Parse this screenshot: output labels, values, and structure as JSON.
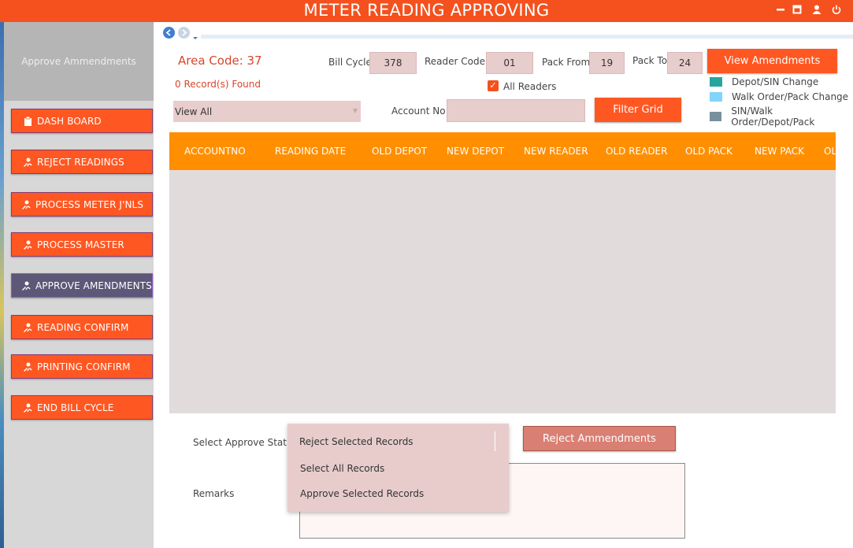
{
  "window": {
    "title": "METER READING APPROVING",
    "controls": [
      {
        "name": "minimize-icon",
        "glyph": "━"
      },
      {
        "name": "maximize-icon",
        "glyph": "▣"
      },
      {
        "name": "user-icon",
        "glyph": "👤"
      },
      {
        "name": "power-icon",
        "glyph": "⏻"
      }
    ]
  },
  "sidebar": {
    "title": "Approve Ammendments",
    "items": [
      {
        "label": "DASH BOARD",
        "icon": "clipboard-icon"
      },
      {
        "label": "REJECT READINGS",
        "icon": "person-edit-icon"
      },
      {
        "label": "PROCESS METER J'NLS",
        "icon": "person-edit-icon"
      },
      {
        "label": "PROCESS MASTER",
        "icon": "person-edit-icon"
      },
      {
        "label": "APPROVE AMENDMENTS",
        "icon": "person-edit-icon",
        "active": true
      },
      {
        "label": "READING CONFIRM",
        "icon": "person-edit-icon"
      },
      {
        "label": "PRINTING CONFIRM",
        "icon": "person-edit-icon"
      },
      {
        "label": "END BILL CYCLE",
        "icon": "person-edit-icon"
      }
    ]
  },
  "header": {
    "area_code": "Area Code: 37",
    "records_found": "0 Record(s) Found",
    "bill_cycle_label": "Bill Cycle",
    "bill_cycle_value": "378",
    "reader_code_label": "Reader Code",
    "reader_code_value": "01",
    "pack_from_label": "Pack From",
    "pack_from_value": "19",
    "pack_to_label": "Pack To",
    "pack_to_value": "24",
    "view_amendments_button": "View Amendments",
    "all_readers_label": "All Readers",
    "all_readers_checked": true,
    "view_select_value": "View All",
    "account_no_label": "Account No",
    "account_no_value": "",
    "filter_button": "Filter Grid"
  },
  "legend": [
    {
      "label": "Depot/SIN Change",
      "color": "#26a69a"
    },
    {
      "label": "Walk Order/Pack Change",
      "color": "#81d4fa"
    },
    {
      "label": "SIN/Walk Order/Depot/Pack",
      "color": "#78909c"
    }
  ],
  "grid": {
    "columns": [
      "ACCOUNTNO",
      "READING DATE",
      "OLD DEPOT",
      "NEW DEPOT",
      "NEW READER",
      "OLD READER",
      "OLD PACK",
      "NEW PACK",
      "OL"
    ]
  },
  "approval": {
    "status_label": "Select Approve Status",
    "dropdown_options": [
      "Reject Selected Records",
      "Select All Records",
      "Approve Selected Records"
    ],
    "reject_button": "Reject Ammendments",
    "remarks_label": "Remarks",
    "remarks_value": ""
  },
  "colors": {
    "accent": "#f4511e",
    "button": "#ff5722",
    "grid_header": "#ff8f00",
    "active_nav": "#5d5778"
  }
}
